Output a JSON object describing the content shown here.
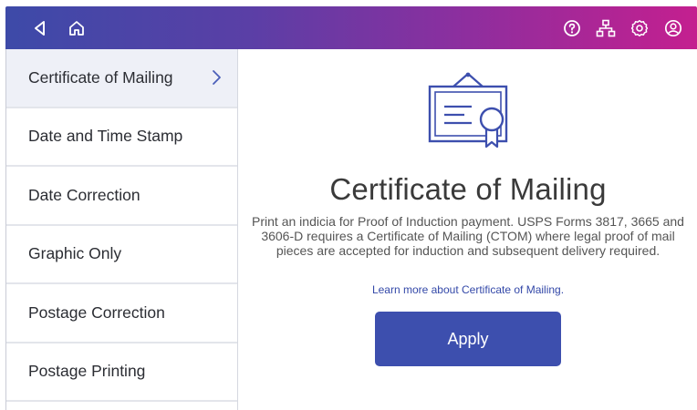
{
  "topbar": {
    "left_icons": [
      "back-icon",
      "home-icon"
    ],
    "right_icons": [
      "help-icon",
      "network-icon",
      "settings-icon",
      "account-icon"
    ],
    "gradient_start": "#3d4aa8",
    "gradient_end": "#c41f8f"
  },
  "sidebar": {
    "items": [
      {
        "label": "Certificate of Mailing",
        "active": true
      },
      {
        "label": "Date and Time Stamp",
        "active": false
      },
      {
        "label": "Date Correction",
        "active": false
      },
      {
        "label": "Graphic Only",
        "active": false
      },
      {
        "label": "Postage Correction",
        "active": false
      },
      {
        "label": "Postage Printing",
        "active": false
      }
    ]
  },
  "main": {
    "icon": "certificate-icon",
    "title": "Certificate of Mailing",
    "description": "Print an indicia for Proof of Induction payment. USPS Forms 3817, 3665 and 3606-D requires a Certificate of Mailing (CTOM) where legal proof of mail pieces are accepted for induction and subsequent delivery required.",
    "learn_more": "Learn more about Certificate of Mailing.",
    "apply_label": "Apply",
    "accent": "#3d4fae"
  }
}
